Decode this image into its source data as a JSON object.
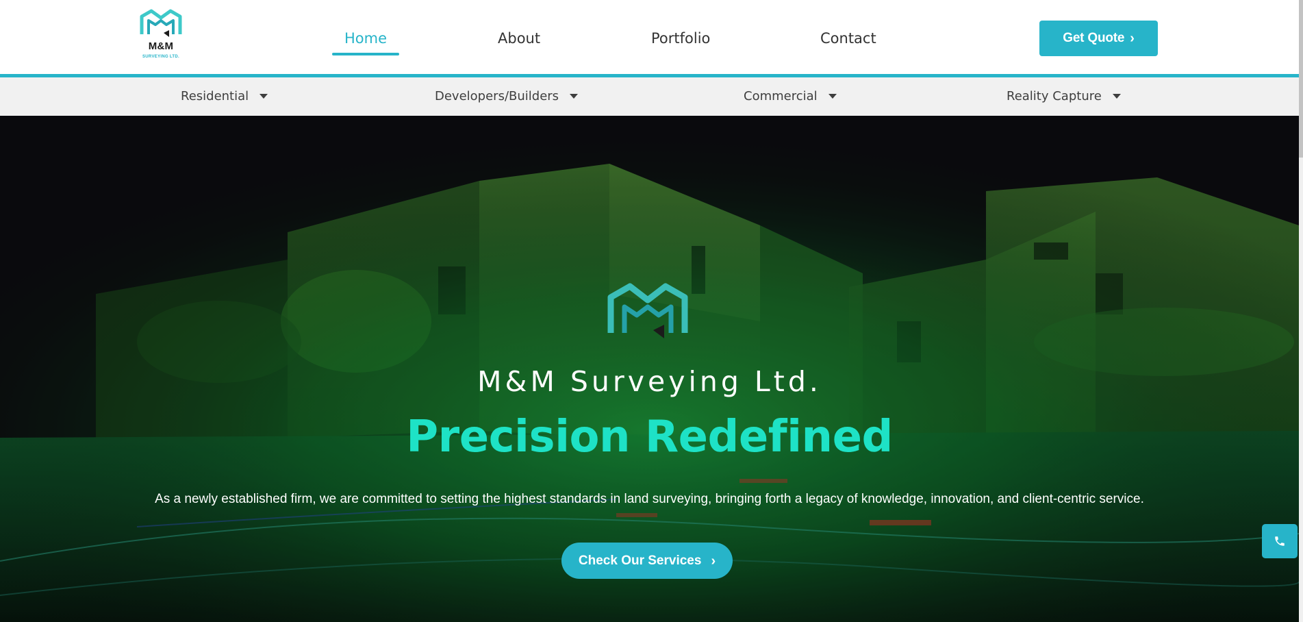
{
  "brand": {
    "logo_name": "M&M",
    "logo_sub": "SURVEYING LTD.",
    "accent_color": "#27b4c9",
    "dark_color": "#1b1b1b",
    "logo_icon": "mm-monogram-icon"
  },
  "nav": {
    "items": [
      "Home",
      "About",
      "Portfolio",
      "Contact"
    ],
    "active": "Home",
    "cta_label": "Get Quote",
    "cta_icon": "chevron-right-icon"
  },
  "subnav": {
    "items": [
      "Residential",
      "Developers/Builders",
      "Commercial",
      "Reality Capture"
    ],
    "dropdown_icon": "caret-down-icon"
  },
  "hero": {
    "company_name": "M&M Surveying Ltd.",
    "tagline": "Precision Redefined",
    "description": "As a newly established firm, we are committed to setting the highest standards in land surveying, bringing forth a legacy of knowledge, innovation, and client-centric service.",
    "button_label": "Check Our Services",
    "tagline_color": "#1ee2c6",
    "background": "green point-cloud scan of residential buildings"
  },
  "floating": {
    "phone_icon": "phone-icon"
  }
}
